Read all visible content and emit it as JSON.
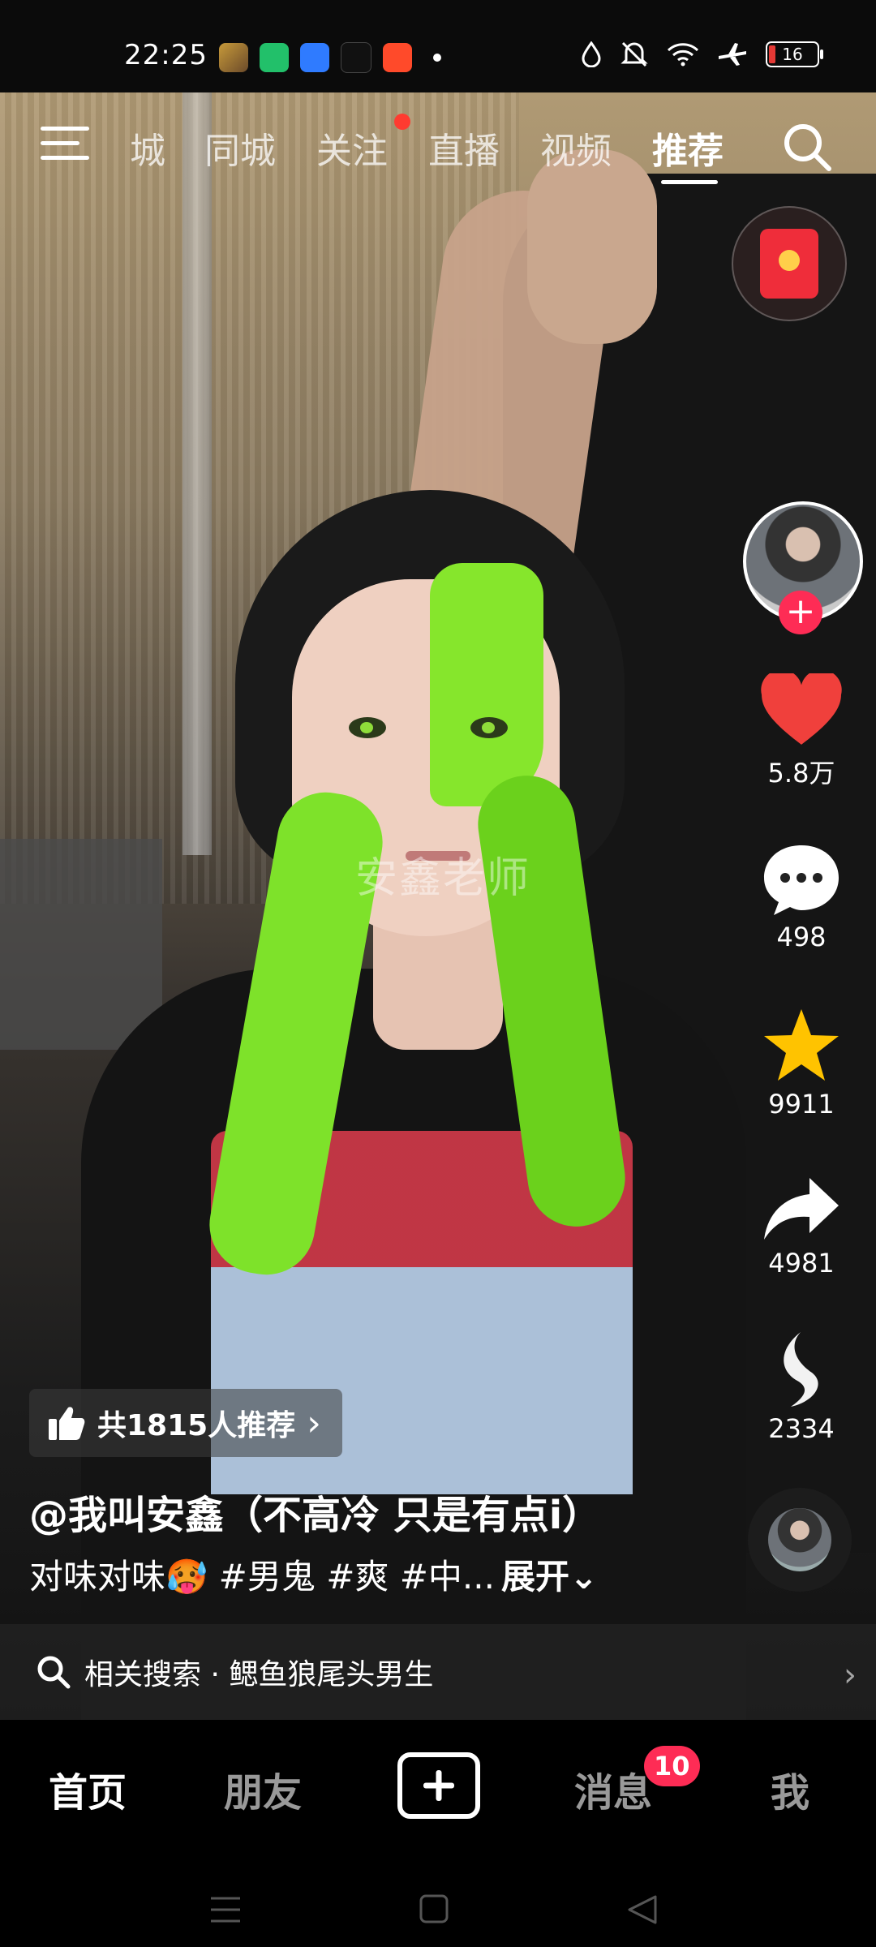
{
  "status_bar": {
    "time": "22:25",
    "battery": "16",
    "app_icons": [
      "game-app-icon",
      "battery-app-icon",
      "search-app-icon",
      "douyin-app-icon",
      "video-app-icon"
    ],
    "system_icons": [
      "water-drop-icon",
      "mute-icon",
      "wifi-icon",
      "airplane-icon",
      "battery-icon"
    ]
  },
  "top_nav": {
    "tabs": [
      {
        "label": "城"
      },
      {
        "label": "同城"
      },
      {
        "label": "关注"
      },
      {
        "label": "直播"
      },
      {
        "label": "视频"
      },
      {
        "label": "推荐"
      }
    ],
    "active_tab": "推荐"
  },
  "video": {
    "watermark": "安鑫老师"
  },
  "right_rail": {
    "likes": "5.8万",
    "comments": "498",
    "favorites": "9911",
    "shares": "4981",
    "gifts": "2334"
  },
  "recommend_chip": {
    "label": "共1815人推荐",
    "chevron": "›"
  },
  "post": {
    "author": "@我叫安鑫（不高冷 只是有点i）",
    "caption": "对味对味🥵 #男鬼 #爽 #中...",
    "expand_label": "展开⌄"
  },
  "related_search": {
    "label": "相关搜索 · 鳃鱼狼尾头男生",
    "chevron": "›"
  },
  "bottom_nav": {
    "home": "首页",
    "friends": "朋友",
    "messages": "消息",
    "messages_badge": "10",
    "me": "我"
  },
  "colors": {
    "accent": "#fe2c55",
    "like": "#f0403c",
    "favorite": "#ffc300"
  }
}
